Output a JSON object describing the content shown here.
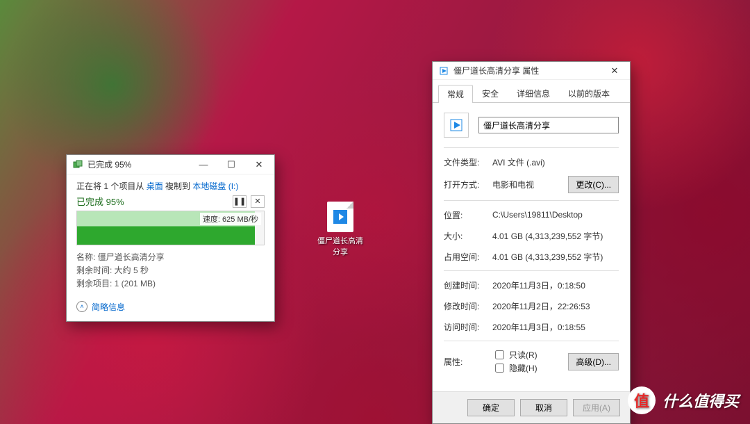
{
  "desktop_icon": {
    "label": "僵尸道长高清分享"
  },
  "copy_dialog": {
    "title": "已完成 95%",
    "status_line_prefix": "正在将 1 个项目从 ",
    "source_link": "桌面",
    "status_line_mid": " 複制到 ",
    "dest_link": "本地磁盘 (I:)",
    "progress_text": "已完成 95%",
    "speed_label": "速度: 625 MB/秒",
    "details": {
      "name_label": "名称: ",
      "name_value": "僵尸道长高清分享",
      "remaining_time_label": "剩余时间: ",
      "remaining_time_value": "大约 5 秒",
      "remaining_items_label": "剩余项目: ",
      "remaining_items_value": "1 (201 MB)"
    },
    "brief_info": "简略信息"
  },
  "props_dialog": {
    "title": "僵尸道长高清分享 属性",
    "tabs": [
      "常规",
      "安全",
      "详细信息",
      "以前的版本"
    ],
    "filename": "僵尸道长高清分享",
    "rows": {
      "file_type_label": "文件类型:",
      "file_type_value": "AVI 文件 (.avi)",
      "open_with_label": "打开方式:",
      "open_with_value": "电影和电视",
      "change_btn": "更改(C)...",
      "location_label": "位置:",
      "location_value": "C:\\Users\\19811\\Desktop",
      "size_label": "大小:",
      "size_value": "4.01 GB (4,313,239,552 字节)",
      "size_on_disk_label": "占用空间:",
      "size_on_disk_value": "4.01 GB (4,313,239,552 字节)",
      "created_label": "创建时间:",
      "created_value": "2020年11月3日，0:18:50",
      "modified_label": "修改时间:",
      "modified_value": "2020年11月2日，22:26:53",
      "accessed_label": "访问时间:",
      "accessed_value": "2020年11月3日，0:18:55",
      "attributes_label": "属性:",
      "readonly_label": "只读(R)",
      "hidden_label": "隐藏(H)",
      "advanced_btn": "高级(D)..."
    },
    "buttons": {
      "ok": "确定",
      "cancel": "取消",
      "apply": "应用(A)"
    }
  },
  "watermark": {
    "badge": "值",
    "text": "什么值得买"
  }
}
